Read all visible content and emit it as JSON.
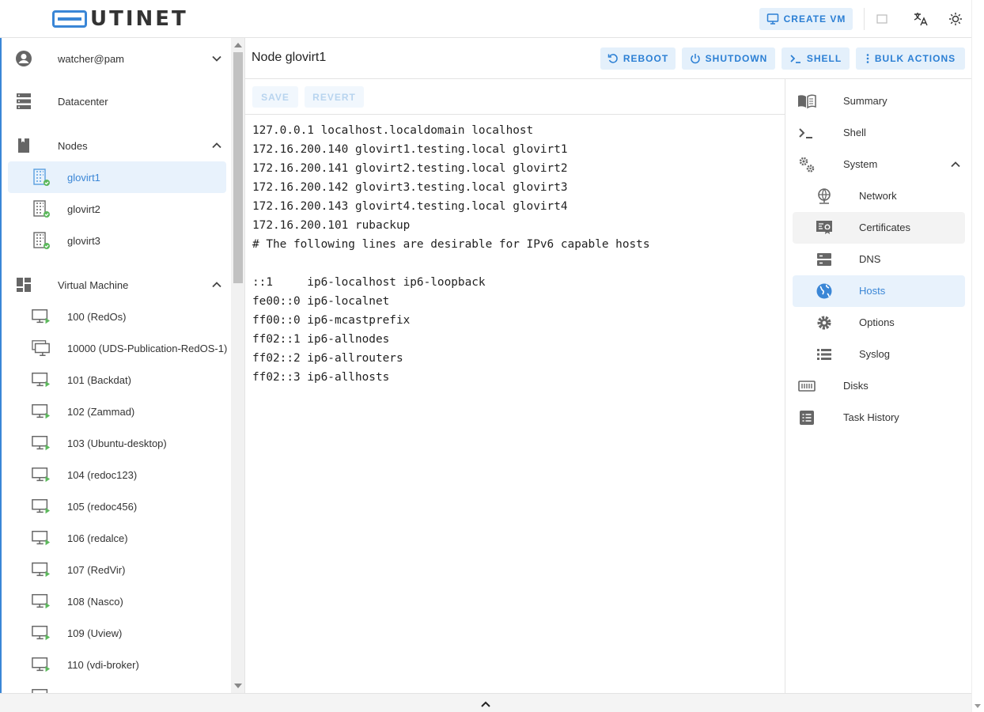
{
  "app": {
    "brand": "UTINET",
    "create_vm_label": "CREATE VM"
  },
  "sidebar": {
    "user": "watcher@pam",
    "datacenter": "Datacenter",
    "nodes_label": "Nodes",
    "nodes": [
      "glovirt1",
      "glovirt2",
      "glovirt3"
    ],
    "vm_label": "Virtual Machine",
    "vms": [
      "100 (RedOs)",
      "10000 (UDS-Publication-RedOS-1)",
      "101 (Backdat)",
      "102 (Zammad)",
      "103 (Ubuntu-desktop)",
      "104 (redoc123)",
      "105 (redoc456)",
      "106 (redalce)",
      "107 (RedVir)",
      "108 (Nasco)",
      "109 (Uview)",
      "110 (vdi-broker)"
    ]
  },
  "header": {
    "title": "Node glovirt1",
    "reboot": "REBOOT",
    "shutdown": "SHUTDOWN",
    "shell": "SHELL",
    "bulk": "BULK ACTIONS"
  },
  "editor": {
    "save": "SAVE",
    "revert": "REVERT",
    "content": "127.0.0.1 localhost.localdomain localhost\n172.16.200.140 glovirt1.testing.local glovirt1\n172.16.200.141 glovirt2.testing.local glovirt2\n172.16.200.142 glovirt3.testing.local glovirt3\n172.16.200.143 glovirt4.testing.local glovirt4\n172.16.200.101 rubackup\n# The following lines are desirable for IPv6 capable hosts\n\n::1     ip6-localhost ip6-loopback\nfe00::0 ip6-localnet\nff00::0 ip6-mcastprefix\nff02::1 ip6-allnodes\nff02::2 ip6-allrouters\nff02::3 ip6-allhosts"
  },
  "rightnav": {
    "summary": "Summary",
    "shell": "Shell",
    "system": "System",
    "network": "Network",
    "certificates": "Certificates",
    "dns": "DNS",
    "hosts": "Hosts",
    "options": "Options",
    "syslog": "Syslog",
    "disks": "Disks",
    "task_history": "Task History"
  },
  "colors": {
    "accent": "#3a86d6",
    "button_bg": "#e4f0fb",
    "selected_bg": "#e8f2fc",
    "status_ok": "#5cb85c"
  }
}
